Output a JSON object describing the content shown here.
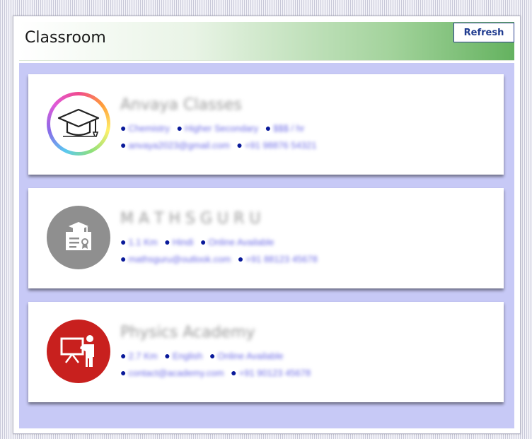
{
  "header": {
    "title": "Classroom",
    "refresh_label": "Refresh",
    "gradient_colors": [
      "#ffffff",
      "#e9f4e6",
      "#a3d39c",
      "#64b25f"
    ]
  },
  "list_background": "#c7c9f6",
  "bullet_color": "#0a1a9a",
  "link_color": "#6d6be6",
  "cards": [
    {
      "icon": "graduation-cap-icon",
      "icon_bg": "rainbow-ring",
      "name": "Anvaya Classes",
      "line1": [
        "Chemistry",
        "Higher Secondary",
        "$$$ / hr"
      ],
      "line2": [
        "anvaya2023@gmail.com",
        "+91 98876 54321"
      ]
    },
    {
      "icon": "certificate-icon",
      "icon_bg": "#8f8f8f",
      "name": "M A T H S G U R U",
      "line1": [
        "1.1 Km",
        "Hindi",
        "Online Available"
      ],
      "line2": [
        "mathsguru@outlook.com",
        "+91 88123 45678"
      ]
    },
    {
      "icon": "teacher-board-icon",
      "icon_bg": "#c8201e",
      "name": "Physics Academy",
      "line1": [
        "2.7 Km",
        "English",
        "Online Available"
      ],
      "line2": [
        "contact@academy.com",
        "+91 90123 45678"
      ]
    }
  ]
}
